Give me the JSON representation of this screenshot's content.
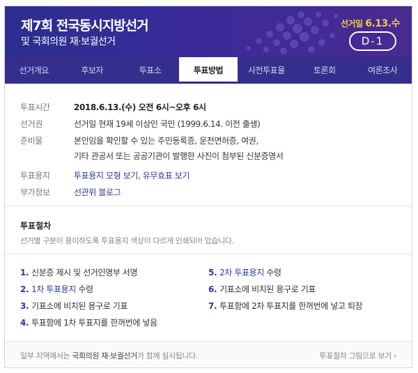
{
  "banner": {
    "title_line1": "제7회 전국동시지방선거",
    "title_line2": "및 국회의원 재·보궐선거",
    "election_day_label": "선거일",
    "election_day_date": "6.13.수",
    "dday": "D-1"
  },
  "tabs": [
    {
      "label": "선거개요",
      "active": false
    },
    {
      "label": "후보자",
      "active": false
    },
    {
      "label": "투표소",
      "active": false
    },
    {
      "label": "투표방법",
      "active": true
    },
    {
      "label": "사전투표율",
      "active": false
    },
    {
      "label": "토론회",
      "active": false
    },
    {
      "label": "여론조사",
      "active": false
    }
  ],
  "info": {
    "time_label": "투표시간",
    "time_value": "2018.6.13.(수) 오전 6시~오후 6시",
    "eligibility_label": "선거권",
    "eligibility_value": "선거일 현재 19세 이상인 국민 (1999.6.14. 이전 출생)",
    "items_label": "준비물",
    "items_value_line1": "본인임을 확인할 수 있는 주민등록증, 운전면허증, 여권,",
    "items_value_line2": "기타 관공서 또는 공공기관이 발행한 사진이 첨부된 신분증명서",
    "ballot_label": "투표용지",
    "ballot_link1": "투표용지 모형 보기",
    "ballot_sep": ", ",
    "ballot_link2": "유무효표 보기",
    "extra_label": "부가정보",
    "extra_link": "선관위 블로그"
  },
  "procedure": {
    "title": "투표절차",
    "description": "선거별 구분이 용이하도록 투표용지 색상이 다르게 인쇄되어 있습니다.",
    "steps": [
      {
        "num": "1.",
        "pre": "신분증 제시 및 선거인명부 서명",
        "hl": "",
        "post": ""
      },
      {
        "num": "2.",
        "pre": "",
        "hl": "1차 투표용지",
        "post": " 수령"
      },
      {
        "num": "3.",
        "pre": "기표소에 비치된 용구로 기표",
        "hl": "",
        "post": ""
      },
      {
        "num": "4.",
        "pre": "투표함에 1차 투표지를 한꺼번에 넣음",
        "hl": "",
        "post": ""
      },
      {
        "num": "5.",
        "pre": "",
        "hl": "2차 투표용지",
        "post": " 수령"
      },
      {
        "num": "6.",
        "pre": "기표소에 비치된 용구로 기표",
        "hl": "",
        "post": ""
      },
      {
        "num": "7.",
        "pre": "투표함에 2차 투표지를 한꺼번에 넣고 퇴장",
        "hl": "",
        "post": ""
      }
    ]
  },
  "footer": {
    "note_pre": "일부 지역에서는 ",
    "note_strong": "국회의원 재·보궐선거",
    "note_post": "가 함께 실시됩니다.",
    "link": "투표절차 그림으로 보기",
    "link_arrow": "›"
  },
  "colors": {
    "banner_bg": "#2a2f8f",
    "tab_bg": "#352e8c",
    "accent_yellow": "#f2c84b",
    "link_blue": "#2b3a9a"
  }
}
